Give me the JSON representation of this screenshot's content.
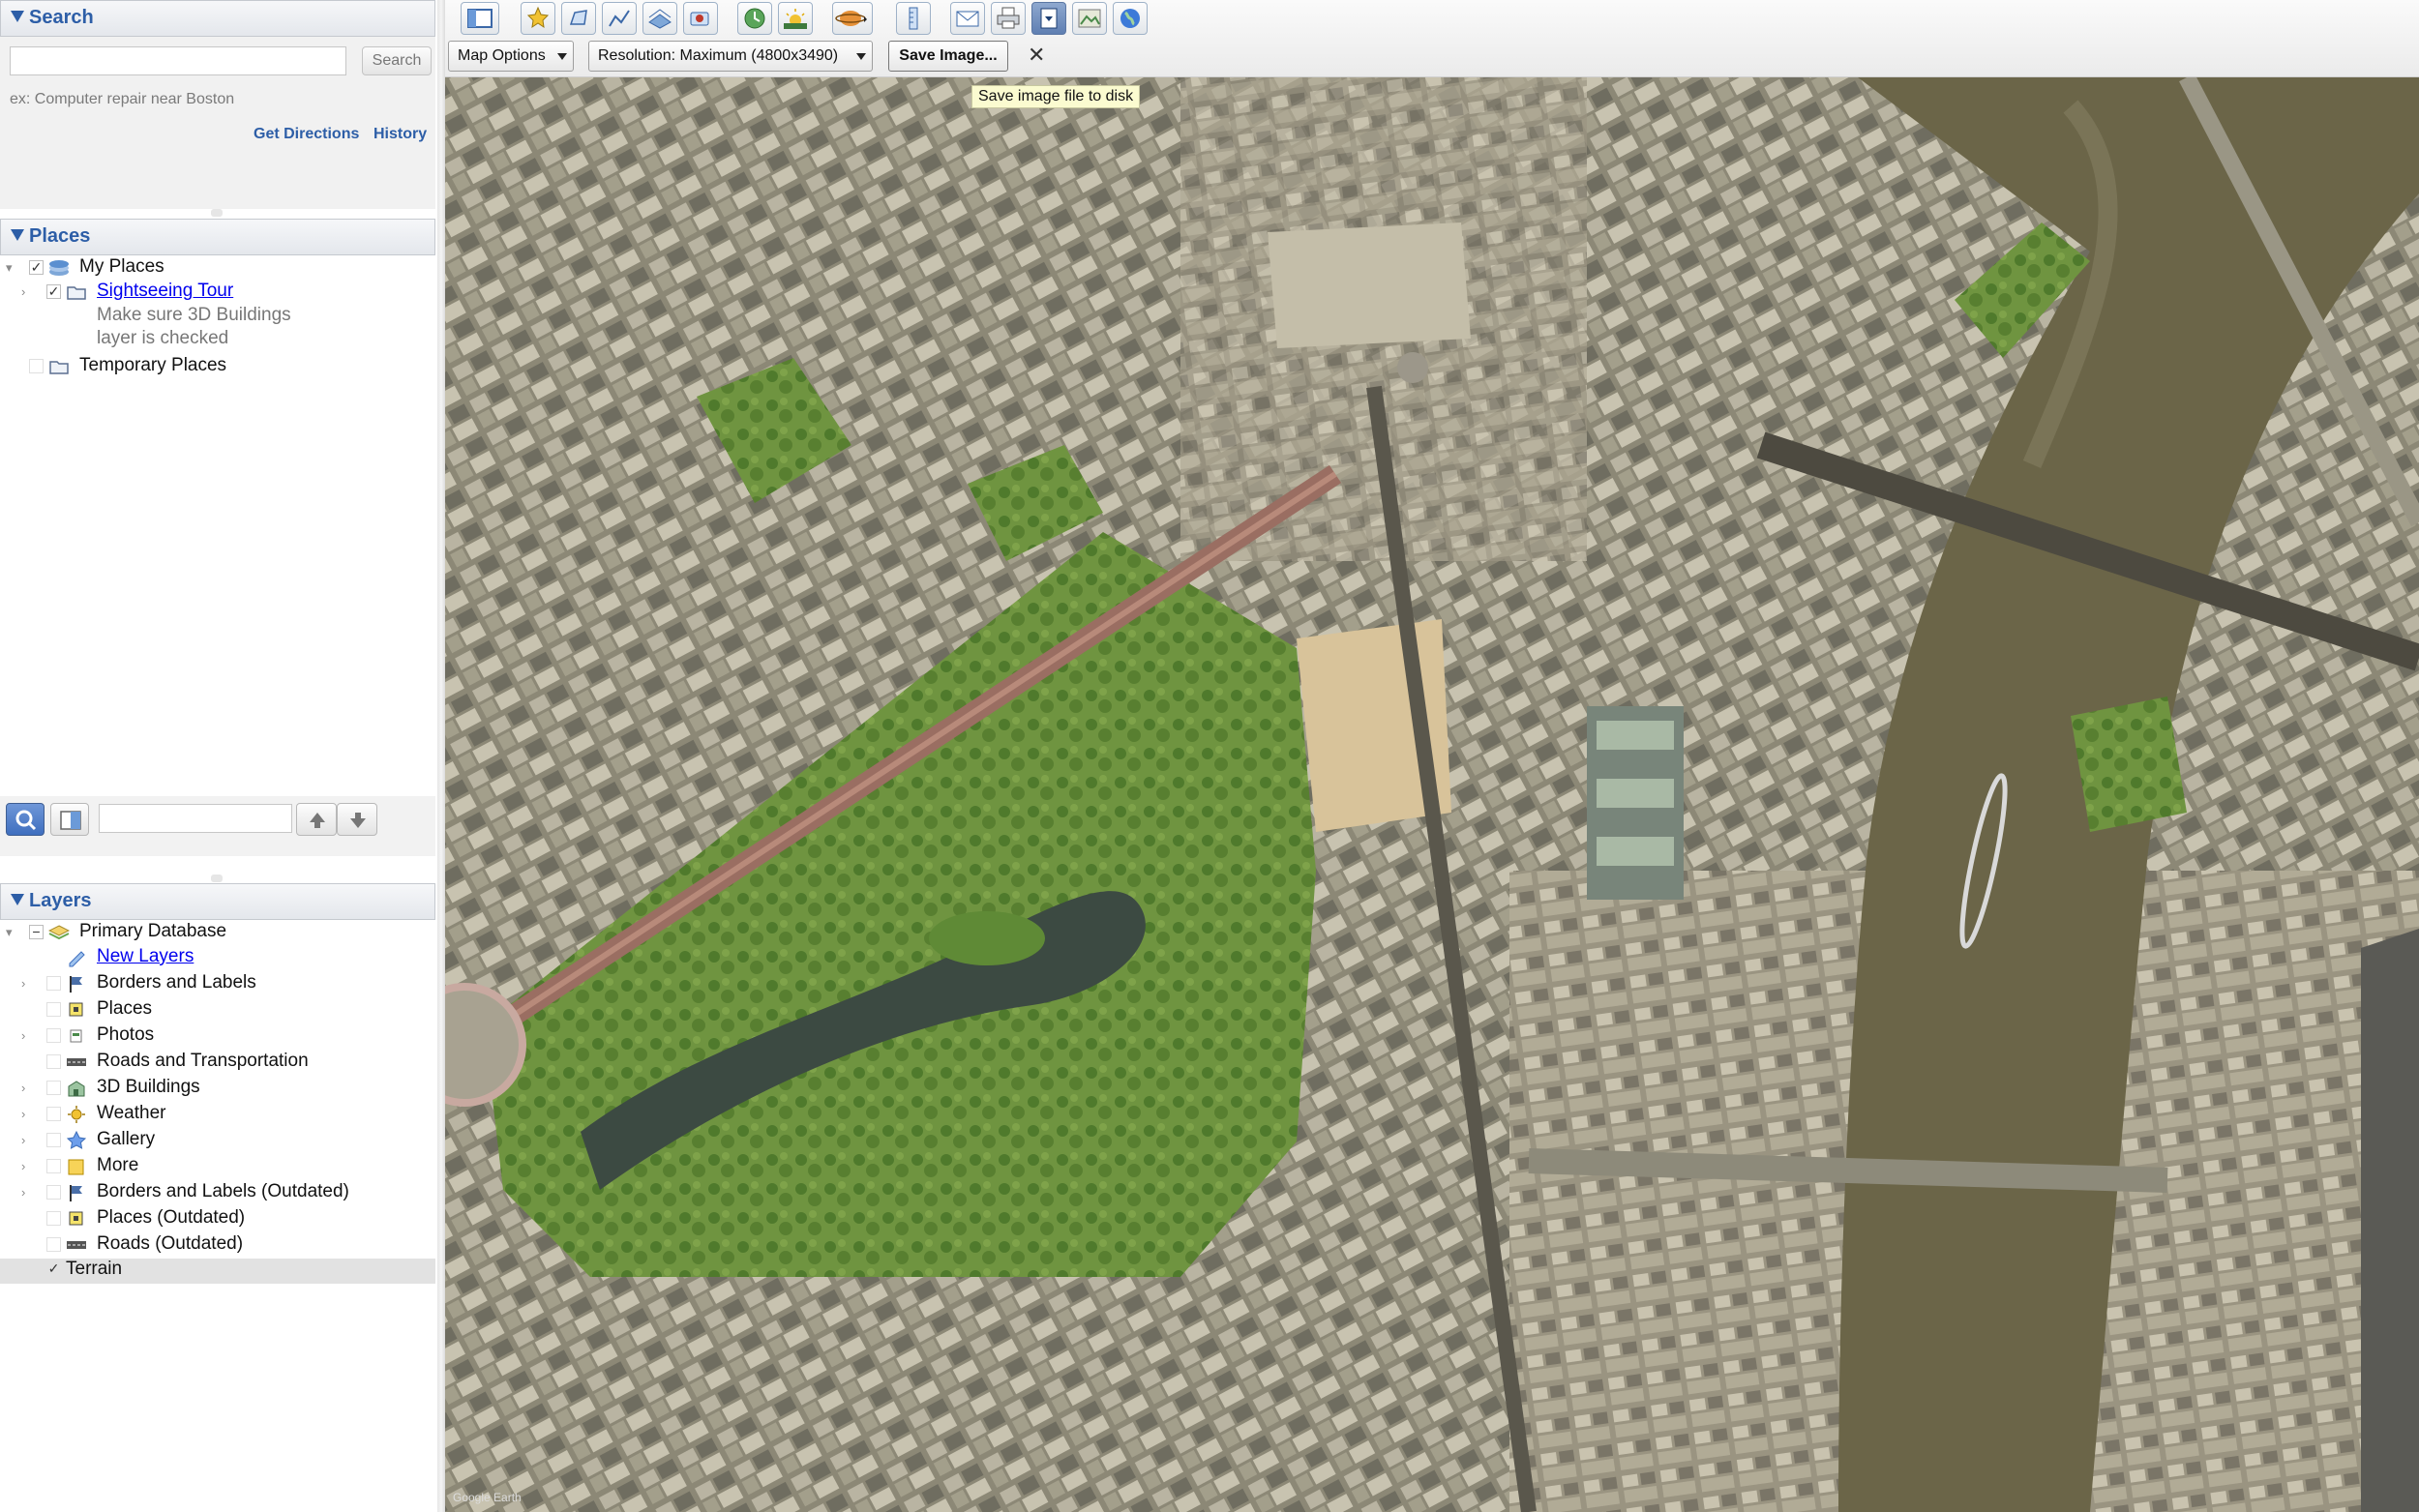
{
  "search": {
    "title": "Search",
    "button": "Search",
    "hint": "ex: Computer repair near Boston",
    "get_directions": "Get Directions",
    "history": "History",
    "placeholder": ""
  },
  "places": {
    "title": "Places",
    "my_places": "My Places",
    "sightseeing_tour": "Sightseeing Tour",
    "tour_note_line1": "Make sure 3D Buildings",
    "tour_note_line2": "layer is checked",
    "temporary_places": "Temporary Places"
  },
  "layers": {
    "title": "Layers",
    "items": [
      {
        "label": "Primary Database",
        "icon": "database-icon",
        "checked": "partial"
      },
      {
        "label": "New Layers",
        "icon": "new-layers-icon",
        "link": true
      },
      {
        "label": "Borders and Labels",
        "icon": "flag-icon"
      },
      {
        "label": "Places",
        "icon": "places-icon"
      },
      {
        "label": "Photos",
        "icon": "photo-icon"
      },
      {
        "label": "Roads and Transportation",
        "icon": "road-icon"
      },
      {
        "label": "3D Buildings",
        "icon": "buildings-icon"
      },
      {
        "label": "Weather",
        "icon": "sun-icon"
      },
      {
        "label": "Gallery",
        "icon": "star-icon"
      },
      {
        "label": "More",
        "icon": "folder-icon"
      },
      {
        "label": "Borders and Labels (Outdated)",
        "icon": "flag-icon"
      },
      {
        "label": "Places (Outdated)",
        "icon": "places-icon"
      },
      {
        "label": "Roads (Outdated)",
        "icon": "road-icon"
      },
      {
        "label": "Terrain",
        "icon": "",
        "checked": true
      }
    ]
  },
  "toolbar": {
    "map_options": "Map Options",
    "resolution": "Resolution: Maximum (4800x3490)",
    "save_image": "Save Image...",
    "close": "✕",
    "tooltip": "Save image file to disk",
    "icons": [
      "sidebar-icon",
      "placemark-icon",
      "polygon-icon",
      "path-icon",
      "image-overlay-icon",
      "tour-icon",
      "historical-imagery-icon",
      "sunlight-icon",
      "planets-icon",
      "ruler-icon",
      "email-icon",
      "print-icon",
      "save-image-icon",
      "maps-icon",
      "earth-icon"
    ]
  },
  "map": {
    "attribution": "Google Earth"
  },
  "colors": {
    "accent": "#2d5ea7",
    "link": "#0000ee",
    "tooltip_bg": "#fbfbd0"
  }
}
